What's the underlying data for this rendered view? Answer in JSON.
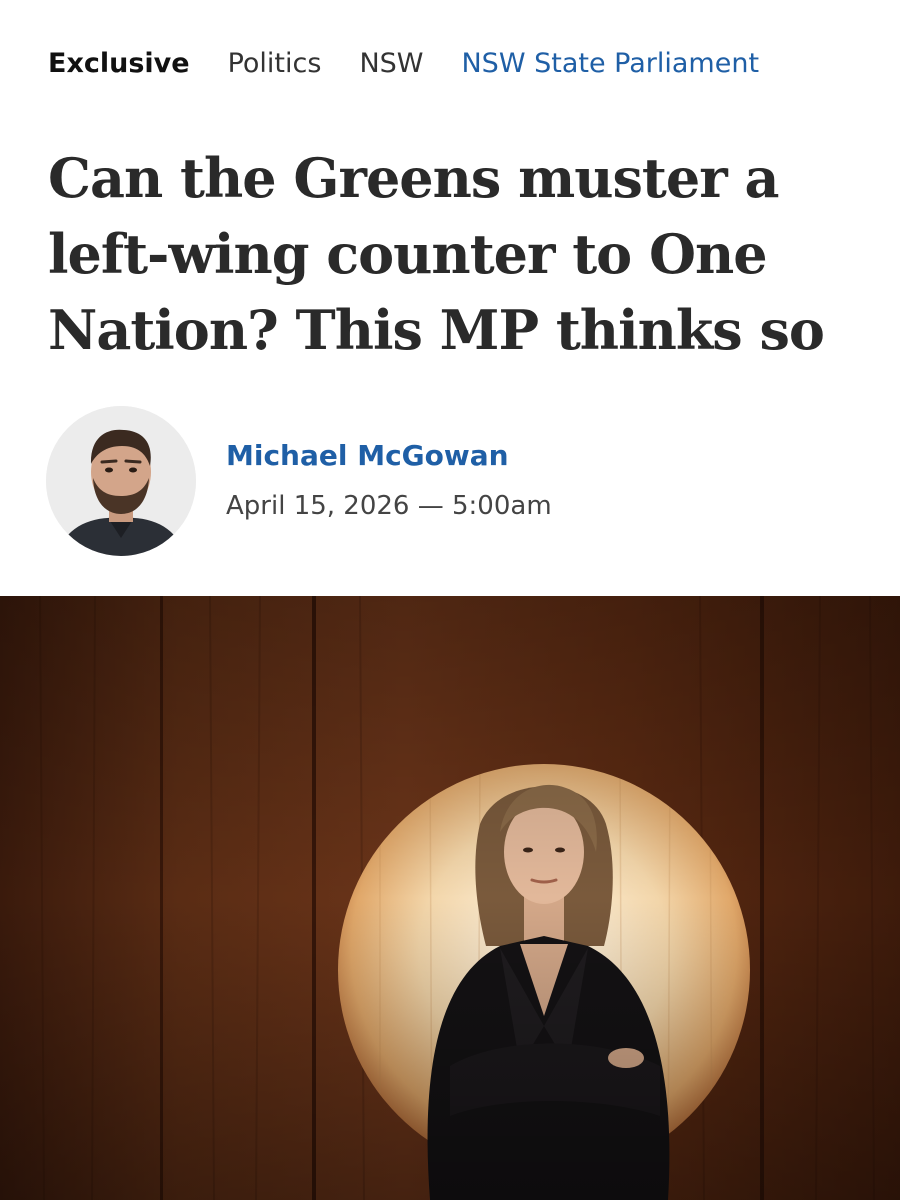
{
  "breadcrumb": {
    "exclusive_label": "Exclusive",
    "section": "Politics",
    "region": "NSW",
    "topic_link": "NSW State Parliament"
  },
  "article": {
    "headline": "Can the Greens muster a left-wing counter to One Nation? This MP thinks so",
    "author": "Michael McGowan",
    "timestamp": "April 15, 2026 — 5:00am"
  },
  "colors": {
    "link_blue": "#1f5fa6",
    "headline_text": "#2a2a2a",
    "body_text": "#444444"
  }
}
